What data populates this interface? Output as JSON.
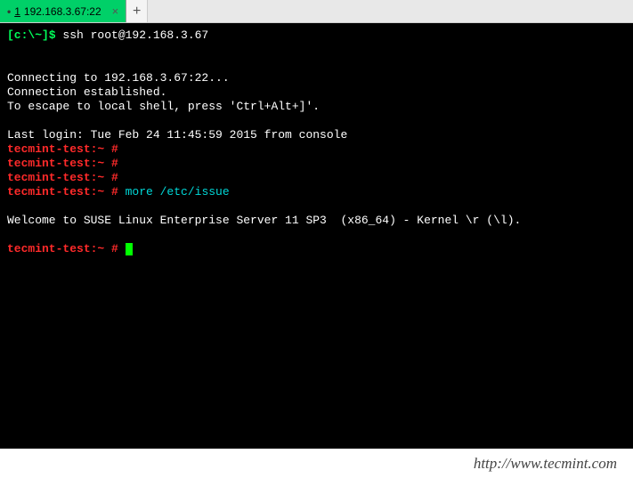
{
  "tab": {
    "indicator": "•",
    "number": "1",
    "title": "192.168.3.67:22",
    "close": "×"
  },
  "newTab": "+",
  "term": {
    "localPrompt": "[c:\\~]$",
    "sshCmd": " ssh root@192.168.3.67",
    "connect1": "Connecting to 192.168.3.67:22...",
    "connect2": "Connection established.",
    "connect3": "To escape to local shell, press 'Ctrl+Alt+]'.",
    "lastLogin": "Last login: Tue Feb 24 11:45:59 2015 from console",
    "remotePrompt": "tecmint-test:~ #",
    "moreCmd": " more /etc/issue",
    "issue": "Welcome to SUSE Linux Enterprise Server 11 SP3  (x86_64) - Kernel \\r (\\l)."
  },
  "footer": "http://www.tecmint.com"
}
